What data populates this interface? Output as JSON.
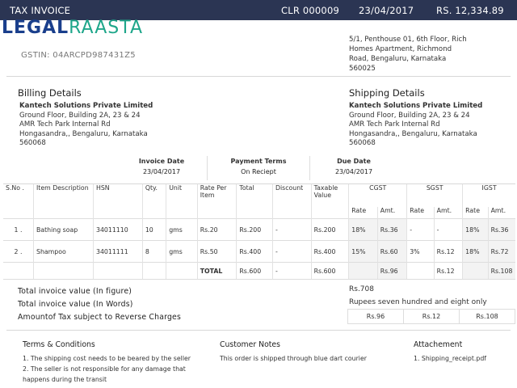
{
  "header": {
    "title": "TAX INVOICE",
    "invoice_no": "CLR 000009",
    "date": "23/04/2017",
    "amount": "RS. 12,334.89"
  },
  "brand": {
    "logo_part1": "LEGAL",
    "logo_part2": "RAASTA",
    "colors": {
      "primary": "#1a3f8c",
      "accent": "#1ea68a",
      "bar": "#2b3553"
    }
  },
  "company": {
    "gstin": "GSTIN: 04ARCPD987431Z5",
    "address": [
      "5/1, Penthouse 01, 6th Floor, Rich",
      "Homes Apartment, Richmond",
      "Road, Bengaluru, Karnataka",
      "560025"
    ]
  },
  "billing": {
    "title": "Billing Details",
    "name": "Kantech Solutions Private Limited",
    "lines": [
      "Ground Floor, Building 2A, 23 & 24",
      "AMR Tech Park Internal Rd",
      "Hongasandra,, Bengaluru, Karnataka",
      "560068"
    ]
  },
  "shipping": {
    "title": "Shipping Details",
    "name": "Kantech Solutions Private Limited",
    "lines": [
      "Ground Floor, Building 2A, 23 & 24",
      "AMR Tech Park Internal Rd",
      "Hongasandra,, Bengaluru, Karnataka",
      "560068"
    ]
  },
  "meta": {
    "invoice_date_label": "Invoice Date",
    "invoice_date": "23/04/2017",
    "payment_terms_label": "Payment Terms",
    "payment_terms": "On Reciept",
    "due_date_label": "Due Date",
    "due_date": "23/04/2017"
  },
  "table": {
    "headers": {
      "sno": "S.No .",
      "item": "Item Description",
      "hsn": "HSN",
      "qty": "Qty.",
      "unit": "Unit",
      "rate": "Rate Per Item",
      "total": "Total",
      "discount": "Discount",
      "taxable": "Taxable Value",
      "cgst": "CGST",
      "sgst": "SGST",
      "igst": "IGST",
      "sub_rate": "Rate",
      "sub_amt": "Amt."
    },
    "rows": [
      {
        "sno": "1 .",
        "item": "Bathing soap",
        "hsn": "34011110",
        "qty": "10",
        "unit": "gms",
        "rate": "Rs.20",
        "total": "Rs.200",
        "discount": "-",
        "taxable": "Rs.200",
        "cgst_rate": "18%",
        "cgst_amt": "Rs.36",
        "sgst_rate": "-",
        "sgst_amt": "-",
        "igst_rate": "18%",
        "igst_amt": "Rs.36"
      },
      {
        "sno": "2 .",
        "item": "Shampoo",
        "hsn": "34011111",
        "qty": "8",
        "unit": "gms",
        "rate": "Rs.50",
        "total": "Rs.400",
        "discount": "-",
        "taxable": "Rs.400",
        "cgst_rate": "15%",
        "cgst_amt": "Rs.60",
        "sgst_rate": "3%",
        "sgst_amt": "Rs.12",
        "igst_rate": "18%",
        "igst_amt": "Rs.72"
      }
    ],
    "totals": {
      "label": "TOTAL",
      "total": "Rs.600",
      "discount": "-",
      "taxable": "Rs.600",
      "cgst_amt": "Rs.96",
      "sgst_amt": "Rs.12",
      "igst_amt": "Rs.108"
    }
  },
  "summary": {
    "figure_label": "Total invoice value (In figure)",
    "figure_value": "Rs.708",
    "words_label": "Total invoice value (In Words)",
    "words_value": "Rupees seven hundred and eight only",
    "reverse_label": "Amountof Tax subject to Reverse Charges",
    "reverse_values": [
      "Rs.96",
      "Rs.12",
      "Rs.108"
    ]
  },
  "footer": {
    "terms_title": "Terms & Conditions",
    "terms": [
      "1. The shipping cost needs to be beared by the seller",
      "2. The seller is not responsible for any damage that",
      "happens during the transit"
    ],
    "notes_title": "Customer Notes",
    "notes": "This order is shipped through blue dart courier",
    "attach_title": "Attachement",
    "attachment": "1. Shipping_receipt.pdf"
  }
}
